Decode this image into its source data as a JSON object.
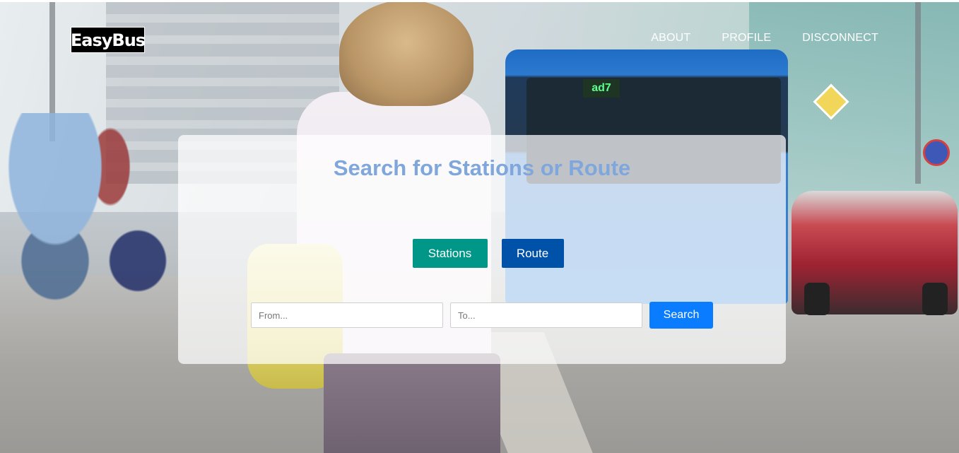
{
  "header": {
    "logo_text": "EasyBus",
    "nav": [
      {
        "label": "ABOUT"
      },
      {
        "label": "PROFILE"
      },
      {
        "label": "DISCONNECT"
      }
    ]
  },
  "background": {
    "bus_sign_text": "ad7"
  },
  "search_panel": {
    "title": "Search for Stations or Route",
    "modes": [
      {
        "label": "Stations",
        "color": "#009688"
      },
      {
        "label": "Route",
        "color": "#0052a8"
      }
    ],
    "from_field": {
      "value": "",
      "placeholder": "From..."
    },
    "to_field": {
      "value": "",
      "placeholder": "To..."
    },
    "search_button": "Search"
  },
  "colors": {
    "title": "#7fa7dc",
    "search_button": "#0a7cff"
  }
}
